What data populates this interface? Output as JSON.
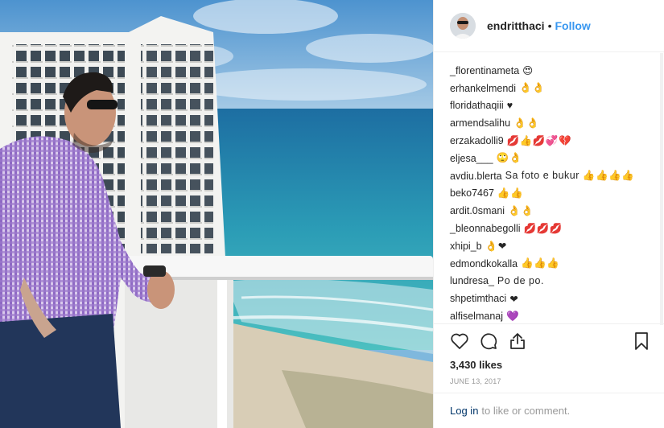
{
  "post": {
    "username": "endritthaci",
    "separator": "•",
    "follow_label": "Follow",
    "likes": "3,430 likes",
    "date": "JUNE 13, 2017",
    "login_label": "Log in",
    "comment_prompt": "to like or comment."
  },
  "comments": [
    {
      "user": "_florentinameta",
      "text": "😍"
    },
    {
      "user": "erhankelmendi",
      "text": "👌👌"
    },
    {
      "user": "floridathaqiii",
      "text": "♥"
    },
    {
      "user": "armendsalihu",
      "text": "👌👌"
    },
    {
      "user": "erzakadolli9",
      "text": "💋👍💋💞💔"
    },
    {
      "user": "eljesa___",
      "text": "🙄👌"
    },
    {
      "user": "avdiu.blerta",
      "text": "Sa foto e bukur 👍👍👍👍"
    },
    {
      "user": "beko7467",
      "text": "👍👍"
    },
    {
      "user": "ardit.0smani",
      "text": "👌👌"
    },
    {
      "user": "_bleonnabegolli",
      "text": "💋💋💋"
    },
    {
      "user": "xhipi_b",
      "text": "👌❤"
    },
    {
      "user": "edmondkokalla",
      "text": "👍👍👍"
    },
    {
      "user": "lundresa_",
      "text": "Po de po."
    },
    {
      "user": "shpetimthaci",
      "text": "❤"
    },
    {
      "user": "alfiselmanaj",
      "text": "💜"
    }
  ],
  "icons": {
    "like": "heart-icon",
    "comment": "speech-bubble-icon",
    "share": "share-arrow-icon",
    "save": "bookmark-icon"
  },
  "colors": {
    "accent": "#3897f0",
    "text": "#262626",
    "muted": "#999999"
  }
}
